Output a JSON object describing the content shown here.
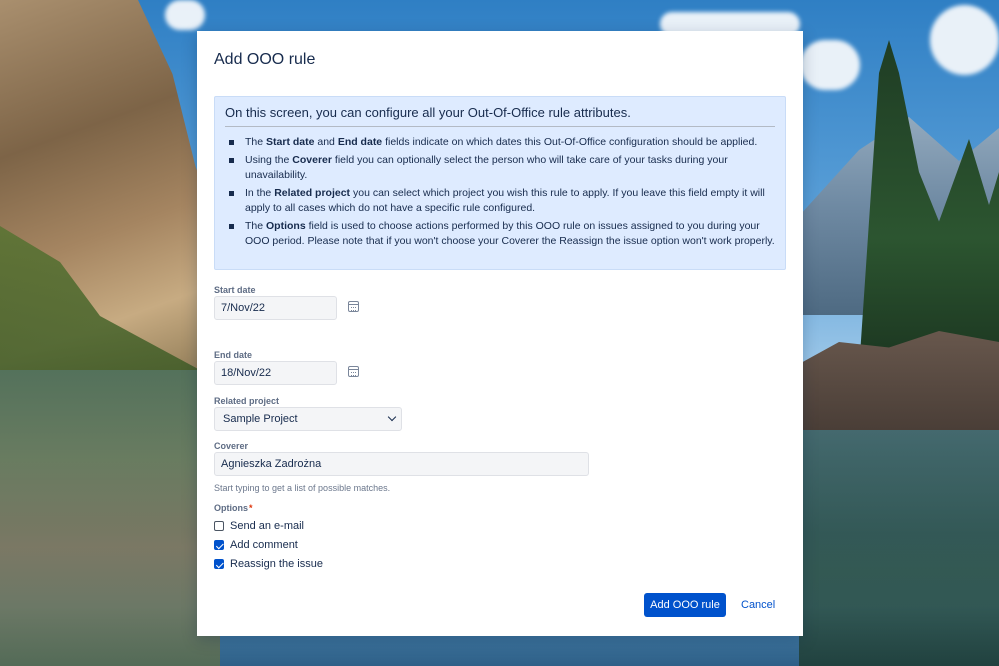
{
  "dialog": {
    "title": "Add OOO rule"
  },
  "info": {
    "heading": "On this screen, you can configure all your Out-Of-Office rule attributes.",
    "items": [
      {
        "parts": [
          {
            "t": "The ",
            "b": false
          },
          {
            "t": "Start date",
            "b": true
          },
          {
            "t": " and ",
            "b": false
          },
          {
            "t": "End date",
            "b": true
          },
          {
            "t": " fields indicate on which dates this Out-Of-Office configuration should be applied.",
            "b": false
          }
        ]
      },
      {
        "parts": [
          {
            "t": "Using the ",
            "b": false
          },
          {
            "t": "Coverer",
            "b": true
          },
          {
            "t": " field you can optionally select the person who will take care of your tasks during your unavailability.",
            "b": false
          }
        ]
      },
      {
        "parts": [
          {
            "t": "In the ",
            "b": false
          },
          {
            "t": "Related project",
            "b": true
          },
          {
            "t": " you can select which project you wish this rule to apply. If you leave this field empty it will apply to all cases which do not have a specific rule configured.",
            "b": false
          }
        ]
      },
      {
        "parts": [
          {
            "t": "The ",
            "b": false
          },
          {
            "t": "Options",
            "b": true
          },
          {
            "t": " field is used to choose actions performed by this OOO rule on issues assigned to you during your OOO period. Please note that if you won't choose your Coverer the Reassign the issue option won't work properly.",
            "b": false
          }
        ]
      }
    ]
  },
  "form": {
    "start_date": {
      "label": "Start date",
      "value": "7/Nov/22",
      "icon": "calendar-icon"
    },
    "end_date": {
      "label": "End date",
      "value": "18/Nov/22",
      "icon": "calendar-icon"
    },
    "related_project": {
      "label": "Related project",
      "value": "Sample Project",
      "icon": "chevron-down-icon"
    },
    "coverer": {
      "label": "Coverer",
      "value": "Agnieszka Zadrożna",
      "hint": "Start typing to get a list of possible matches."
    },
    "options": {
      "label": "Options",
      "required_marker": "*",
      "items": [
        {
          "label": "Send an e-mail",
          "checked": false
        },
        {
          "label": "Add comment",
          "checked": true
        },
        {
          "label": "Reassign the issue",
          "checked": true
        }
      ]
    }
  },
  "buttons": {
    "submit": "Add OOO rule",
    "cancel": "Cancel"
  },
  "colors": {
    "primary": "#0052cc",
    "info_bg": "#deebff"
  }
}
